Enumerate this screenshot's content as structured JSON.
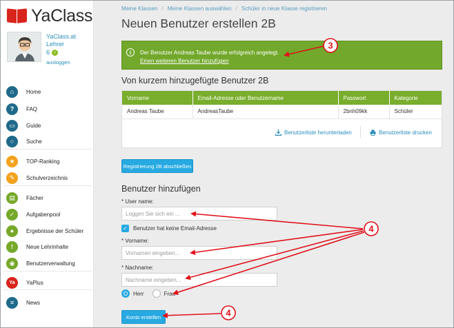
{
  "logo": {
    "text": "YaClass"
  },
  "profile": {
    "name": "YaClass.at Lehrer",
    "level": "6",
    "logout": "ausloggen"
  },
  "nav": [
    {
      "label": "Home",
      "icon": "home-icon",
      "color": "#1f6a8a"
    },
    {
      "label": "FAQ",
      "icon": "question-icon",
      "color": "#1f6a8a"
    },
    {
      "label": "Guide",
      "icon": "monitor-icon",
      "color": "#1f6a8a"
    },
    {
      "label": "Suche",
      "icon": "search-icon",
      "color": "#1f6a8a"
    },
    {
      "label": "TOP-Ranking",
      "icon": "star-icon",
      "color": "#f3a21c"
    },
    {
      "label": "Schulverzeichnis",
      "icon": "school-icon",
      "color": "#f3a21c"
    },
    {
      "label": "Fächer",
      "icon": "book-icon",
      "color": "#76a82a"
    },
    {
      "label": "Aufgabenpool",
      "icon": "check-icon",
      "color": "#76a82a"
    },
    {
      "label": "Ergebnisse der Schüler",
      "icon": "users-icon",
      "color": "#76a82a"
    },
    {
      "label": "Neue Lehrinhalte",
      "icon": "exclamation-icon",
      "color": "#76a82a"
    },
    {
      "label": "Benutzerverwaltung",
      "icon": "user-settings-icon",
      "color": "#76a82a"
    },
    {
      "label": "YaPlus",
      "icon": "yaplus-icon",
      "color": "#d9241c"
    },
    {
      "label": "News",
      "icon": "chat-icon",
      "color": "#1f6a8a"
    }
  ],
  "breadcrumb": [
    "Meine Klassen",
    "Meine Klassen auswählen",
    "Schüler in neue Klasse registrieren"
  ],
  "page_title": "Neuen Benutzer erstellen 2B",
  "alert": {
    "icon_glyph": "i",
    "message": "Der Benutzer Andreas Taube wurde erfolgreich angelegt.",
    "link": "Einen weiteren Benutzer hinzufügen"
  },
  "recent": {
    "heading": "Von kurzem hinzugefügte Benutzer 2B",
    "columns": [
      "Vorname",
      "Email-Adresse oder Benutzername",
      "Passwort",
      "Kategorie"
    ],
    "rows": [
      [
        "Andreas Taube",
        "AndreasTaube",
        "2bnh09kk",
        "Schüler"
      ]
    ],
    "download": "Benutzerliste herunterladen",
    "print": "Benutzerliste drucken"
  },
  "finish_button": "Registrierung 2B abschließen",
  "add_user": {
    "heading": "Benutzer hinzufügen",
    "user_name_label": "* User name:",
    "user_name_placeholder": "Loggen Sie sich ein ...",
    "no_email_label": "Benutzer hat keine Email-Adresse",
    "firstname_label": "* Vorname:",
    "firstname_placeholder": "Vornamen eingeben...",
    "lastname_label": "* Nachname:",
    "lastname_placeholder": "Nachname eingeben...",
    "gender_options": [
      "Herr",
      "Frau"
    ],
    "submit": "Konto erstellen"
  },
  "callouts": [
    "3",
    "4",
    "4"
  ],
  "colors": {
    "accent_green": "#72a82b",
    "button_blue": "#27a9e1",
    "annotation_red": "#e0101a"
  }
}
